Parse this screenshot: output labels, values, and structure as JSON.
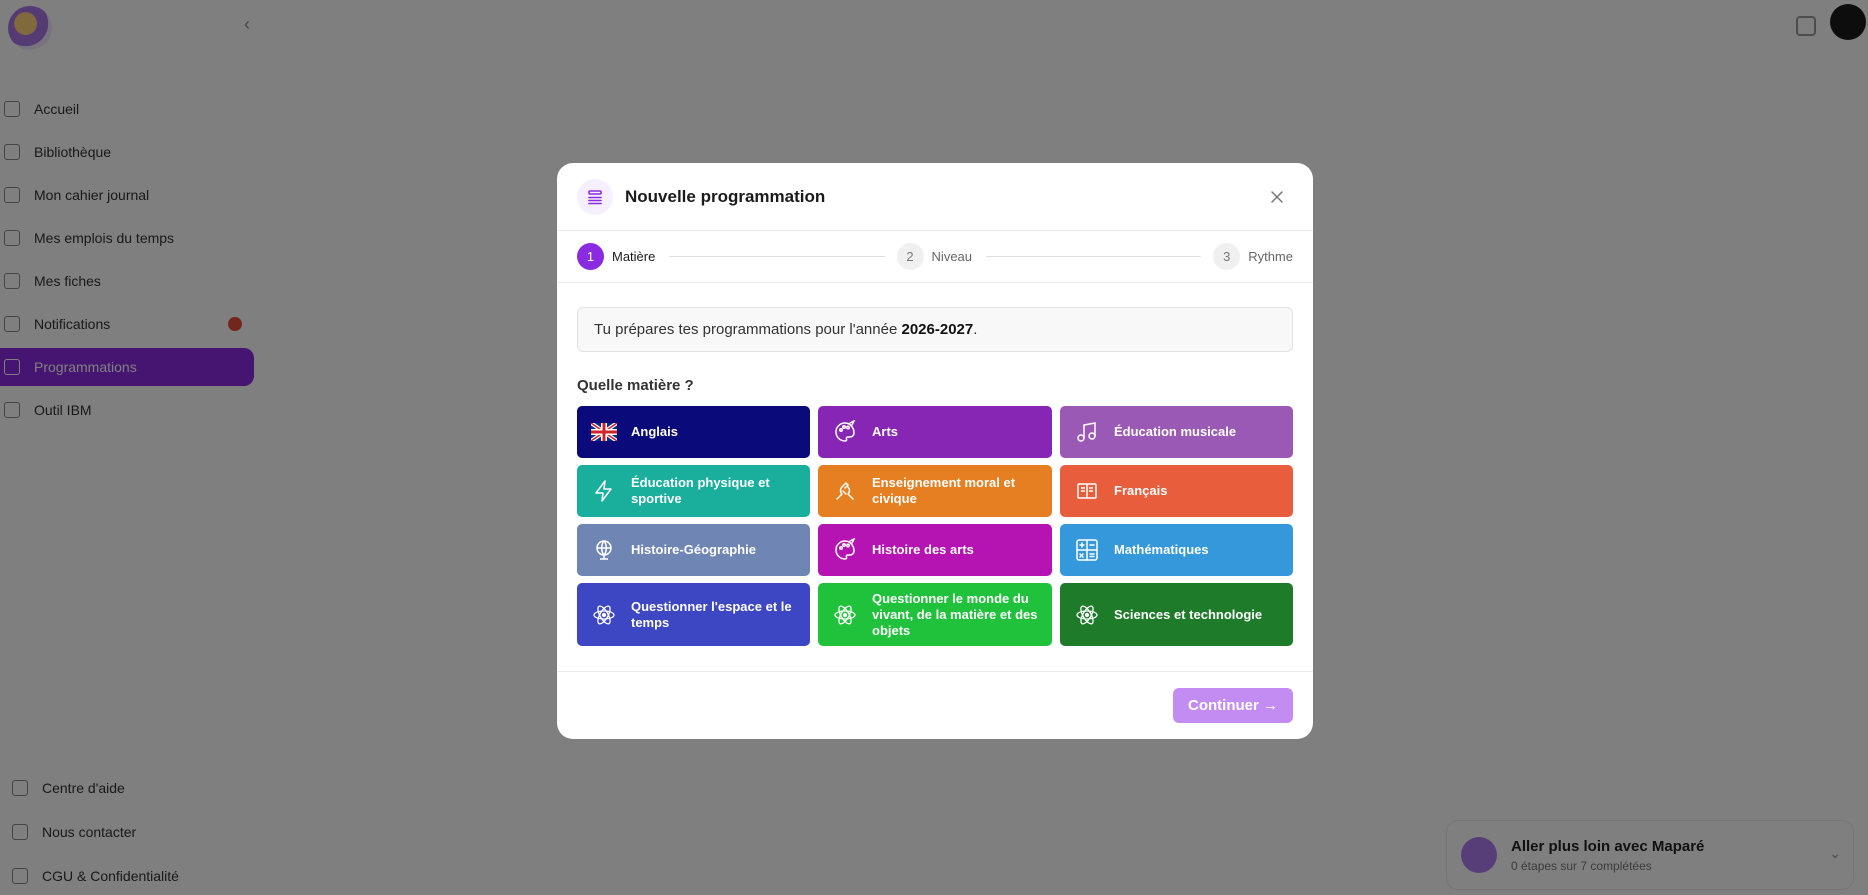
{
  "sidebar": {
    "items": [
      {
        "label": "Accueil"
      },
      {
        "label": "Bibliothèque"
      },
      {
        "label": "Mon cahier journal"
      },
      {
        "label": "Mes emplois du temps"
      },
      {
        "label": "Mes fiches"
      },
      {
        "label": "Notifications"
      },
      {
        "label": "Programmations"
      },
      {
        "label": "Outil IBM"
      }
    ],
    "bottom_items": [
      {
        "label": "Centre d'aide"
      },
      {
        "label": "Nous contacter"
      },
      {
        "label": "CGU & Confidentialité"
      }
    ]
  },
  "toast": {
    "title": "Aller plus loin avec Maparé",
    "subtitle": "0 étapes sur 7 complétées"
  },
  "modal": {
    "title": "Nouvelle programmation",
    "steps": [
      {
        "number": "1",
        "label": "Matière"
      },
      {
        "number": "2",
        "label": "Niveau"
      },
      {
        "number": "3",
        "label": "Rythme"
      }
    ],
    "info_prefix": "Tu prépares tes programmations pour l'année ",
    "info_year": "2026-2027",
    "info_suffix": ".",
    "question": "Quelle matière ?",
    "subjects": [
      {
        "label": "Anglais",
        "color": "#0a0a7a",
        "icon": "uk-flag-icon"
      },
      {
        "label": "Arts",
        "color": "#8726b4",
        "icon": "palette-icon"
      },
      {
        "label": "Éducation musicale",
        "color": "#9b59b6",
        "icon": "music-note-icon"
      },
      {
        "label": "Éducation physique et sportive",
        "color": "#1aaf9c",
        "icon": "lightning-icon"
      },
      {
        "label": "Enseignement moral et civique",
        "color": "#e67e22",
        "icon": "hands-icon"
      },
      {
        "label": "Français",
        "color": "#e85d3c",
        "icon": "book-icon"
      },
      {
        "label": "Histoire-Géographie",
        "color": "#6f86b5",
        "icon": "globe-icon"
      },
      {
        "label": "Histoire des arts",
        "color": "#b514b3",
        "icon": "palette-icon"
      },
      {
        "label": "Mathématiques",
        "color": "#3498db",
        "icon": "calculator-icon"
      },
      {
        "label": "Questionner l'espace et le temps",
        "color": "#3d47c4",
        "icon": "atom-icon"
      },
      {
        "label": "Questionner le monde du vivant, de la matière et des objets",
        "color": "#1fc23a",
        "icon": "atom-icon"
      },
      {
        "label": "Sciences et technologie",
        "color": "#1e7b2a",
        "icon": "atom-icon"
      }
    ],
    "continue_label": "Continuer →"
  }
}
